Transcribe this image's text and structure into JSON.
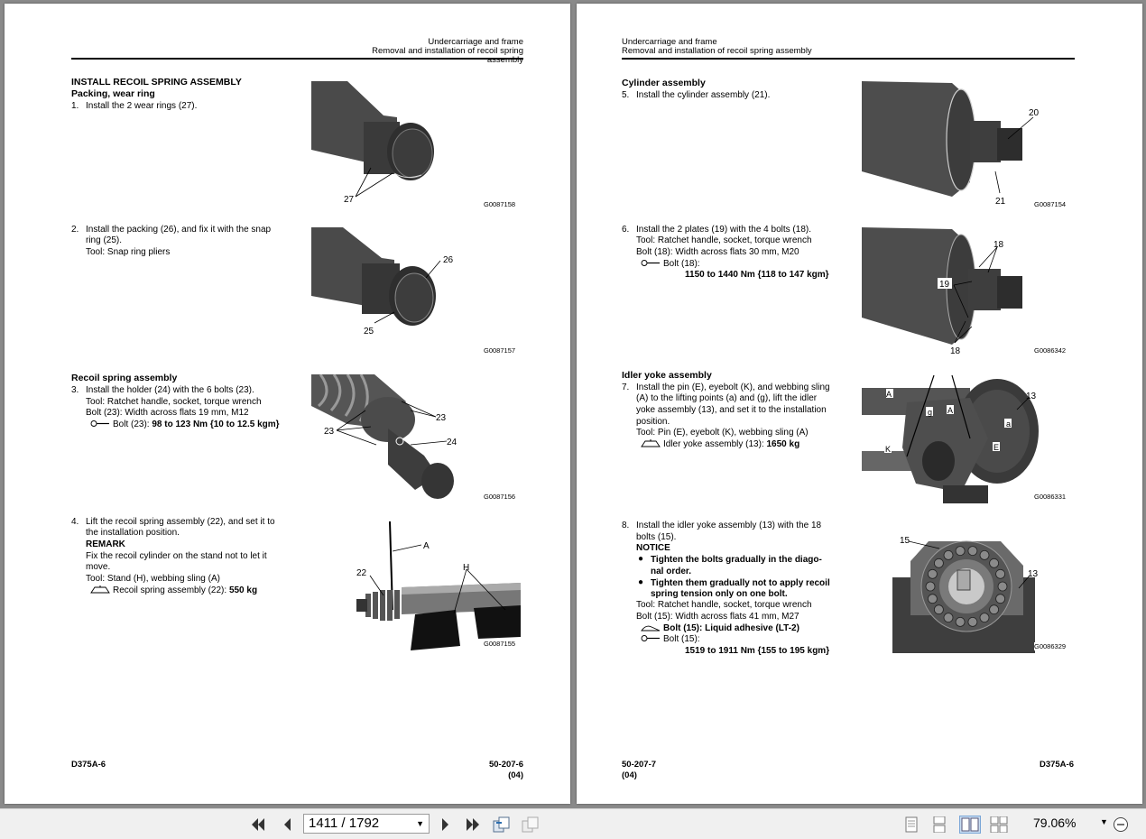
{
  "left_page": {
    "header": {
      "line1": "Undercarriage and frame",
      "line2": "Removal and installation of recoil spring assembly"
    },
    "section_title": "INSTALL RECOIL SPRING ASSEMBLY",
    "sub_packing": "Packing, wear ring",
    "step1": "1.",
    "step1_text": "Install the 2 wear rings (27).",
    "fig1_label": "27",
    "fig1_code": "G0087158",
    "step2": "2.",
    "step2_l1": "Install the packing (26), and fix it with the snap",
    "step2_l2": "ring (25).",
    "step2_tool": "Tool: Snap ring pliers",
    "fig2_labels": [
      "26",
      "25"
    ],
    "fig2_code": "G0087157",
    "sub_recoil": "Recoil spring assembly",
    "step3": "3.",
    "step3_text": "Install the holder (24) with the 6 bolts (23).",
    "step3_tool": "Tool: Ratchet handle, socket, torque wrench",
    "step3_bolt": "Bolt (23): Width across flats 19 mm, M12",
    "step3_torque_label": "Bolt (23): ",
    "step3_torque_value": "98 to 123 Nm {10 to 12.5 kgm}",
    "fig3_labels": [
      "23",
      "23",
      "24"
    ],
    "fig3_code": "G0087156",
    "step4": "4.",
    "step4_l1": "Lift the recoil spring assembly (22), and set it to",
    "step4_l2": "the installation position.",
    "remark": "REMARK",
    "remark_l1": "Fix the recoil cylinder on the stand not to let it",
    "remark_l2": "move.",
    "step4_tool": "Tool: Stand (H), webbing sling (A)",
    "step4_weight_label": "Recoil spring assembly (22): ",
    "step4_weight_value": "550 kg",
    "fig4_labels": [
      "A",
      "22",
      "H"
    ],
    "fig4_code": "G0087155",
    "footer_left": "D375A-6",
    "footer_right1": "50-207-6",
    "footer_right2": "(04)"
  },
  "right_page": {
    "header": {
      "line1": "Undercarriage and frame",
      "line2": "Removal and installation of recoil spring assembly"
    },
    "sub_cylinder": "Cylinder assembly",
    "step5": "5.",
    "step5_text": "Install the cylinder assembly (21).",
    "fig5_labels": [
      "20",
      "21"
    ],
    "fig5_code": "G0087154",
    "step6": "6.",
    "step6_text": "Install the 2 plates (19) with the 4 bolts (18).",
    "step6_tool": "Tool: Ratchet handle, socket, torque wrench",
    "step6_bolt": "Bolt (18): Width across flats 30 mm, M20",
    "step6_torque_label": "Bolt (18):",
    "step6_torque_value": "1150 to 1440 Nm {118 to 147 kgm}",
    "fig6_labels": [
      "18",
      "19",
      "18"
    ],
    "fig6_code": "G0086342",
    "sub_idler": "Idler yoke assembly",
    "step7": "7.",
    "step7_l1": "Install the pin (E), eyebolt (K), and webbing sling",
    "step7_l2": "(A) to the lifting points (a) and (g), lift the idler",
    "step7_l3": "yoke assembly (13), and set it to the installation",
    "step7_l4": "position.",
    "step7_tool": "Tool: Pin (E), eyebolt (K), webbing sling (A)",
    "step7_weight_label": "Idler yoke assembly (13): ",
    "step7_weight_value": "1650 kg",
    "fig7_labels": [
      "A",
      "g",
      "A",
      "13",
      "a",
      "E",
      "K"
    ],
    "fig7_code": "G0086331",
    "step8": "8.",
    "step8_l1": "Install the idler yoke assembly (13) with the 18",
    "step8_l2": "bolts (15).",
    "notice": "NOTICE",
    "notice_b1_l1": "Tighten the bolts gradually in the diago-",
    "notice_b1_l2": "nal order.",
    "notice_b2_l1": "Tighten them gradually not to apply recoil",
    "notice_b2_l2": "spring tension only on one bolt.",
    "step8_tool": "Tool: Ratchet handle, socket, torque wrench",
    "step8_bolt": "Bolt (15): Width across flats 41 mm, M27",
    "step8_adhesive": "Bolt (15): Liquid adhesive (LT-2)",
    "step8_torque_label": "Bolt (15):",
    "step8_torque_value": "1519 to 1911 Nm {155 to 195 kgm}",
    "fig8_labels": [
      "15",
      "13"
    ],
    "fig8_code": "G0086329",
    "footer_left1": "50-207-7",
    "footer_left2": "(04)",
    "footer_right": "D375A-6"
  },
  "toolbar": {
    "page_value": "1411 / 1792",
    "zoom": "79.06%"
  },
  "icons": {
    "first": "first-page-icon",
    "prev": "prev-page-icon",
    "next": "next-page-icon",
    "last": "last-page-icon",
    "back": "go-back-icon",
    "forward": "go-forward-icon",
    "single": "single-page-icon",
    "continuous": "continuous-icon",
    "facing": "facing-pages-icon",
    "cont_facing": "continuous-facing-icon",
    "zoom_out": "zoom-out-icon"
  }
}
